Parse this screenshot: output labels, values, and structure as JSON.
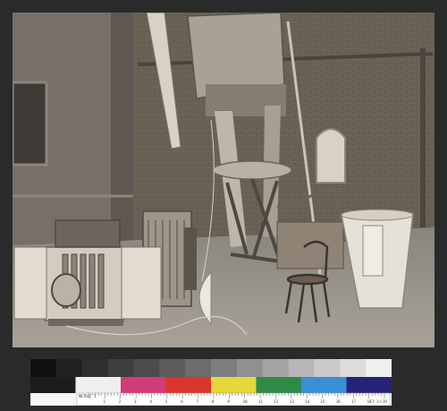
{
  "image": {
    "subject": "observatory telescope interior photograph"
  },
  "color_target": {
    "brand_label": "METRIC 1",
    "scale_numbers": [
      "1",
      "2",
      "3",
      "4",
      "5",
      "6",
      "7",
      "8",
      "9",
      "10",
      "11",
      "12",
      "13",
      "14",
      "15",
      "16",
      "17",
      "18",
      "19"
    ],
    "catalog_number": "CP 3/4",
    "gray_steps": [
      "#111111",
      "#222222",
      "#2f2f2f",
      "#3d3d3d",
      "#4c4c4c",
      "#5c5c5c",
      "#6c6c6c",
      "#7e7e7e",
      "#909090",
      "#a3a3a3",
      "#b6b6b6",
      "#c9c9c9",
      "#dcdcdc",
      "#eeeeee"
    ],
    "color_patches": [
      "#1c1c1c",
      "#efefef",
      "#d03b78",
      "#d9352c",
      "#e6d83a",
      "#2f8a48",
      "#3a8ed6",
      "#262477"
    ]
  }
}
